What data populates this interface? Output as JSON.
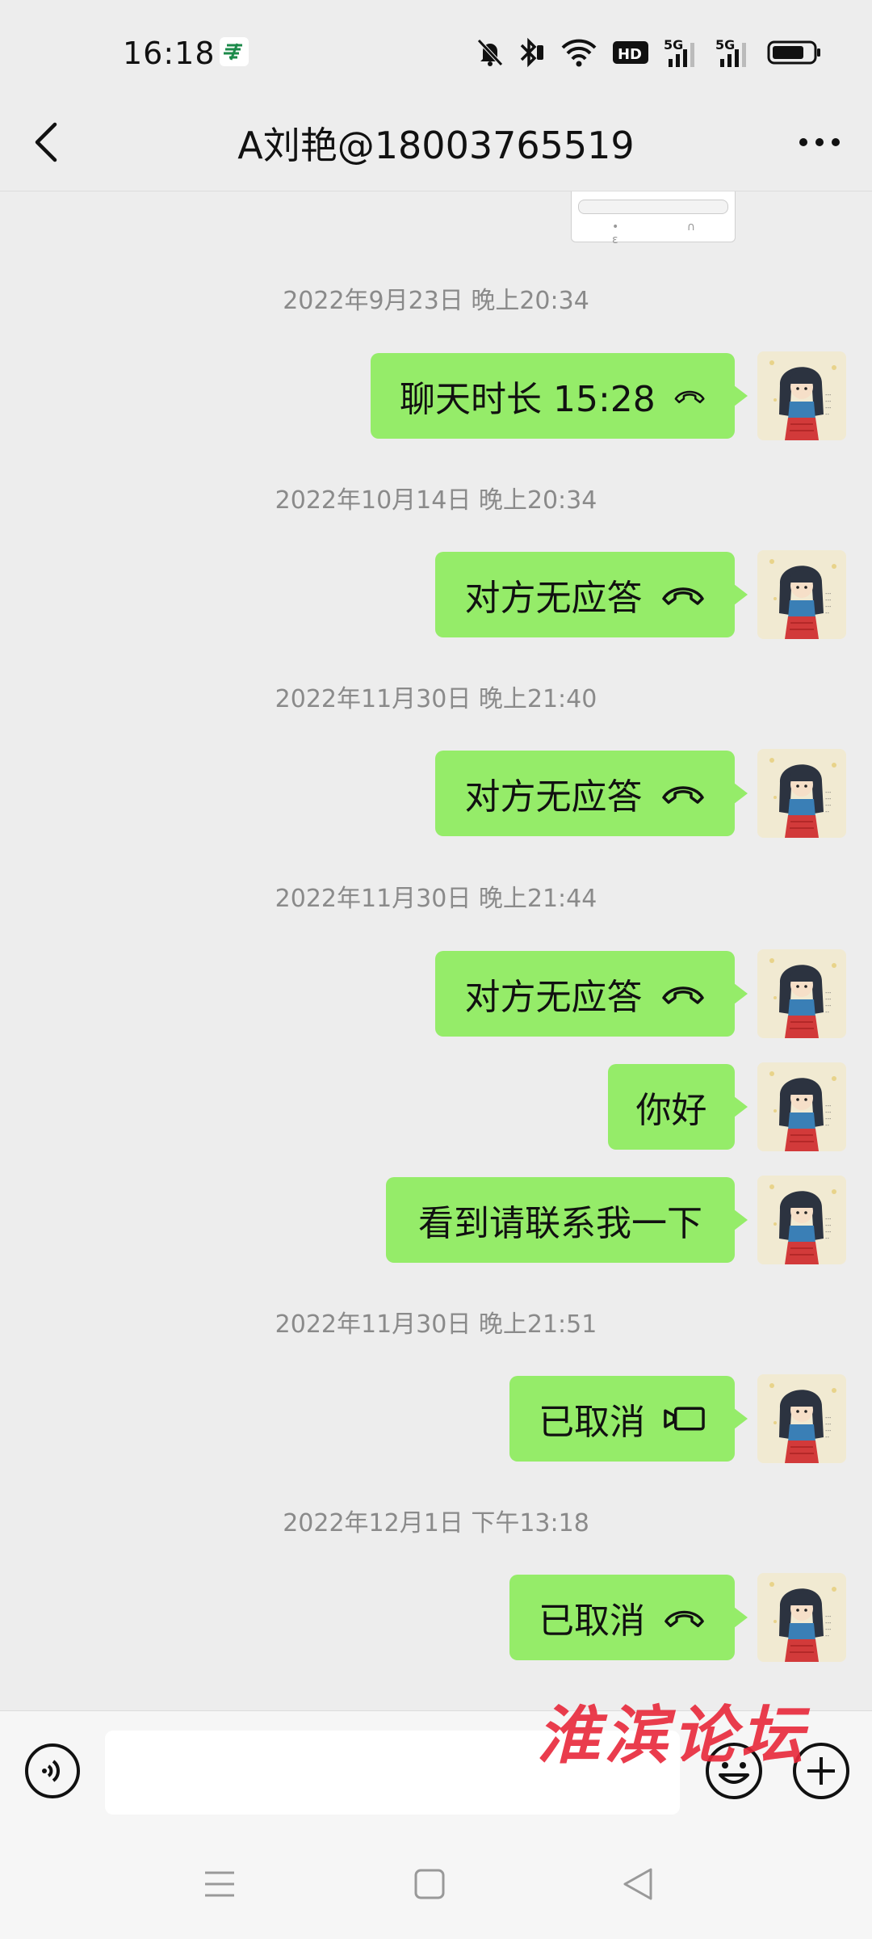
{
  "status_bar": {
    "time": "16:18",
    "app_icon": "china-post-icon",
    "hd_label": "HD",
    "sim1_label": "5G",
    "sim2_label": "5G",
    "icons": [
      "mute-bell-icon",
      "bluetooth-icon",
      "wifi-icon",
      "hd-icon",
      "signal-5g-icon",
      "signal-5g-icon",
      "battery-icon"
    ]
  },
  "header": {
    "title": "A刘艳@18003765519",
    "back_icon": "chevron-left-icon",
    "more_icon": "more-dots-icon"
  },
  "messages": [
    {
      "timestamp": "2022年9月23日 晚上20:34",
      "bubbles": [
        {
          "text": "聊天时长 15:28",
          "icon": "phone-hangup-icon"
        }
      ]
    },
    {
      "timestamp": "2022年10月14日 晚上20:34",
      "bubbles": [
        {
          "text": "对方无应答",
          "icon": "phone-hangup-icon"
        }
      ]
    },
    {
      "timestamp": "2022年11月30日 晚上21:40",
      "bubbles": [
        {
          "text": "对方无应答",
          "icon": "phone-hangup-icon"
        }
      ]
    },
    {
      "timestamp": "2022年11月30日 晚上21:44",
      "bubbles": [
        {
          "text": "对方无应答",
          "icon": "phone-hangup-icon"
        },
        {
          "text": "你好",
          "icon": ""
        },
        {
          "text": "看到请联系我一下",
          "icon": ""
        }
      ]
    },
    {
      "timestamp": "2022年11月30日 晚上21:51",
      "bubbles": [
        {
          "text": "已取消",
          "icon": "video-call-icon"
        }
      ]
    },
    {
      "timestamp": "2022年12月1日 下午13:18",
      "bubbles": [
        {
          "text": "已取消",
          "icon": "phone-hangup-icon"
        }
      ]
    }
  ],
  "input_bar": {
    "voice_icon": "voice-input-icon",
    "emoji_icon": "emoji-icon",
    "plus_icon": "plus-icon",
    "text_value": ""
  },
  "watermark": "淮滨论坛",
  "system_nav": {
    "icons": [
      "menu-icon",
      "home-icon",
      "back-triangle-icon"
    ]
  },
  "colors": {
    "bubble": "#95ec69",
    "background": "#ededed",
    "timestamp": "#8a8a8a",
    "watermark": "#e8283a"
  }
}
